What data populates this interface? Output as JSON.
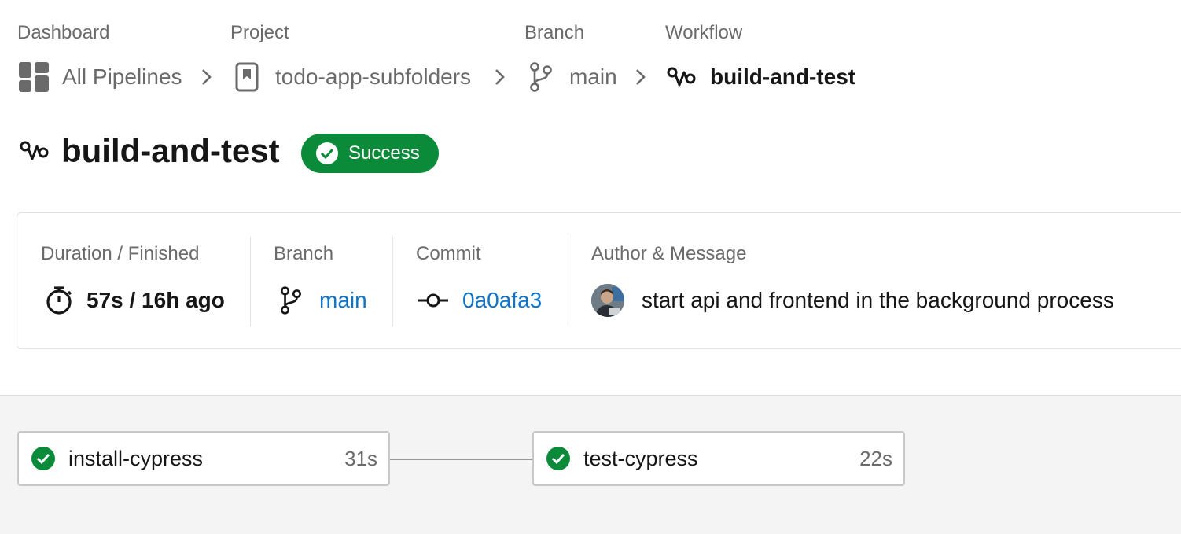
{
  "breadcrumb": {
    "dashboard_label": "Dashboard",
    "dashboard_link": "All Pipelines",
    "project_label": "Project",
    "project_link": "todo-app-subfolders",
    "branch_label": "Branch",
    "branch_link": "main",
    "workflow_label": "Workflow",
    "workflow_current": "build-and-test"
  },
  "title": "build-and-test",
  "status": {
    "label": "Success",
    "color": "#0b8a3a"
  },
  "summary": {
    "duration_label": "Duration / Finished",
    "duration_value": "57s / 16h ago",
    "branch_label": "Branch",
    "branch_value": "main",
    "commit_label": "Commit",
    "commit_value": "0a0afa3",
    "author_label": "Author & Message",
    "message": "start api and frontend in the background process"
  },
  "jobs": [
    {
      "name": "install-cypress",
      "duration": "31s",
      "status": "success"
    },
    {
      "name": "test-cypress",
      "duration": "22s",
      "status": "success"
    }
  ],
  "colors": {
    "link": "#0f74c7",
    "success": "#0b8a3a",
    "muted_text": "#6a6a6a"
  },
  "icons": {
    "dashboard": "dashboard-grid-icon",
    "project": "bookmark-icon",
    "branch": "git-branch-icon",
    "workflow": "workflow-icon",
    "timer": "stopwatch-icon",
    "commit": "git-commit-icon",
    "check": "check-circle-icon",
    "separator": "chevron-right-icon"
  }
}
